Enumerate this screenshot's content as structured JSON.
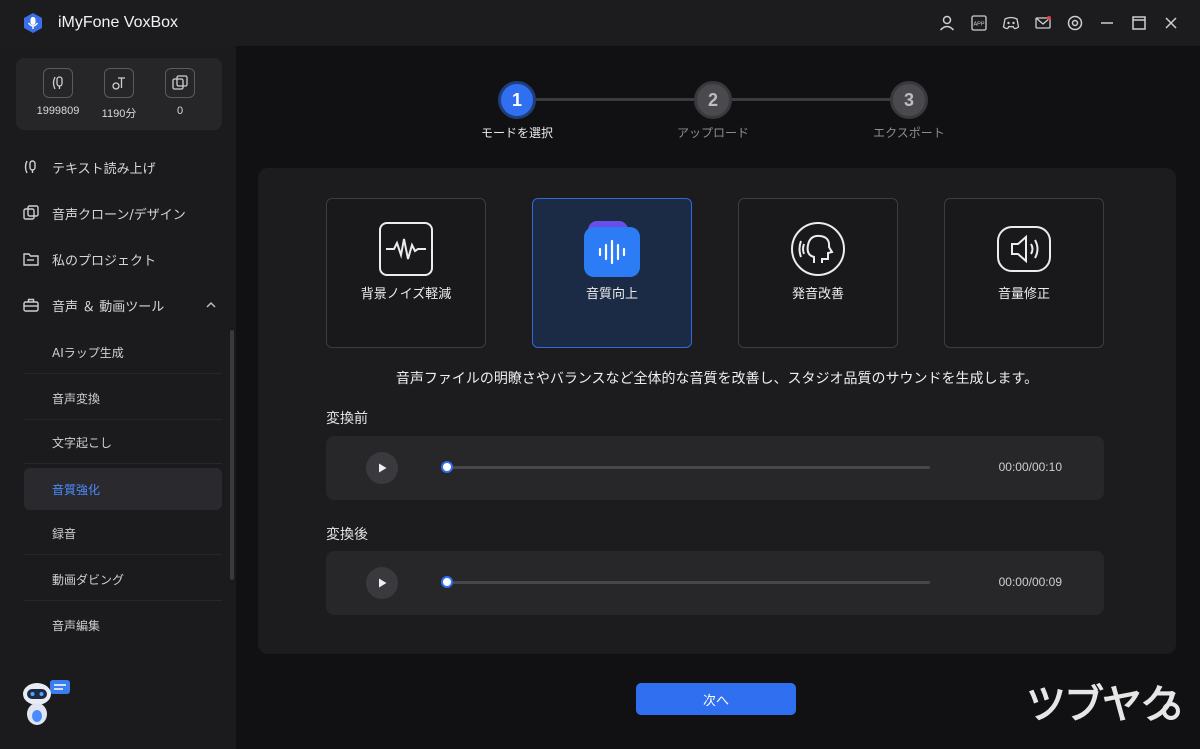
{
  "app": {
    "title": "iMyFone VoxBox"
  },
  "titlebar": {
    "icons": [
      "user-icon",
      "app-icon",
      "discord-icon",
      "mail-icon",
      "settings-icon",
      "minimize-icon",
      "maximize-icon",
      "close-icon"
    ],
    "app_icon_text": "APP"
  },
  "sidebar": {
    "stats": [
      {
        "icon": "voice-icon",
        "value": "1999809"
      },
      {
        "icon": "text-time-icon",
        "value": "1190分"
      },
      {
        "icon": "clone-icon",
        "value": "0"
      }
    ],
    "nav": [
      {
        "label": "テキスト読み上げ",
        "icon": "tts-icon"
      },
      {
        "label": "音声クローン/デザイン",
        "icon": "clone-icon"
      },
      {
        "label": "私のプロジェクト",
        "icon": "folder-icon"
      },
      {
        "label": "音声 ＆ 動画ツール",
        "icon": "toolbox-icon"
      }
    ],
    "tools": [
      {
        "label": "AIラップ生成"
      },
      {
        "label": "音声変換"
      },
      {
        "label": "文字起こし"
      },
      {
        "label": "音質強化",
        "active": true
      },
      {
        "label": "録音"
      },
      {
        "label": "動画ダビング"
      },
      {
        "label": "音声編集"
      }
    ]
  },
  "steps": [
    {
      "number": "1",
      "label": "モードを選択",
      "active": true
    },
    {
      "number": "2",
      "label": "アップロード",
      "active": false
    },
    {
      "number": "3",
      "label": "エクスポート",
      "active": false
    }
  ],
  "modes": [
    {
      "label": "背景ノイズ軽減",
      "icon": "waveform-icon",
      "selected": false
    },
    {
      "label": "音質向上",
      "icon": "audio-bars-icon",
      "selected": true
    },
    {
      "label": "発音改善",
      "icon": "speaking-head-icon",
      "selected": false
    },
    {
      "label": "音量修正",
      "icon": "speaker-icon",
      "selected": false
    }
  ],
  "description": "音声ファイルの明瞭さやバランスなど全体的な音質を改善し、スタジオ品質のサウンドを生成します。",
  "players": [
    {
      "label": "変換前",
      "time": "00:00/00:10",
      "progress": 0
    },
    {
      "label": "変換後",
      "time": "00:00/00:09",
      "progress": 0
    }
  ],
  "next_button": "次へ",
  "watermark": "ツブヤク",
  "colors": {
    "accent": "#2f6ff0",
    "active_text": "#4a8bff",
    "bg": "#111113"
  }
}
